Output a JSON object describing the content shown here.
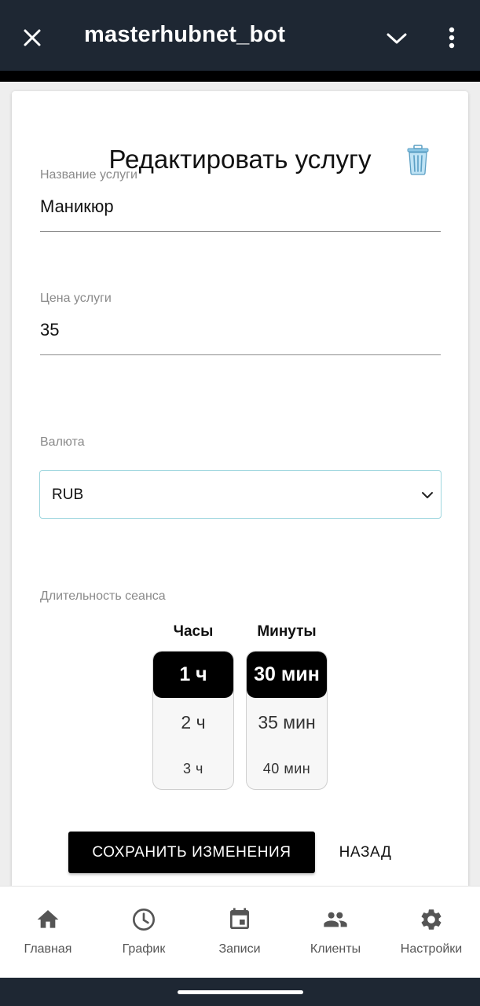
{
  "header": {
    "title": "masterhubnet_bot",
    "close_icon": "close-icon",
    "chevron_icon": "chevron-down-icon",
    "more_icon": "more-vertical-icon"
  },
  "form": {
    "title": "Редактировать услугу",
    "delete_icon": "trash-icon",
    "name_label": "Название услуги",
    "name_value": "Маникюр",
    "price_label": "Цена услуги",
    "price_value": "35",
    "currency_label": "Валюта",
    "currency_value": "RUB",
    "duration_label": "Длительность сеанса",
    "hours": {
      "header": "Часы",
      "options": [
        "1 ч",
        "2 ч",
        "3 ч"
      ],
      "selected": "1 ч"
    },
    "minutes": {
      "header": "Минуты",
      "options": [
        "30 мин",
        "35 мин",
        "40 мин"
      ],
      "selected": "30 мин"
    },
    "save_label": "СОХРАНИТЬ ИЗМЕНЕНИЯ",
    "back_label": "НАЗАД"
  },
  "nav": {
    "items": [
      {
        "label": "Главная",
        "icon": "home-icon"
      },
      {
        "label": "График",
        "icon": "clock-icon"
      },
      {
        "label": "Записи",
        "icon": "calendar-icon"
      },
      {
        "label": "Клиенты",
        "icon": "people-icon"
      },
      {
        "label": "Настройки",
        "icon": "gear-icon"
      }
    ]
  },
  "colors": {
    "topbar": "#1e2733",
    "accent_focus": "#9ed6de",
    "primary_button": "#000000",
    "nav_icon": "#555555"
  }
}
